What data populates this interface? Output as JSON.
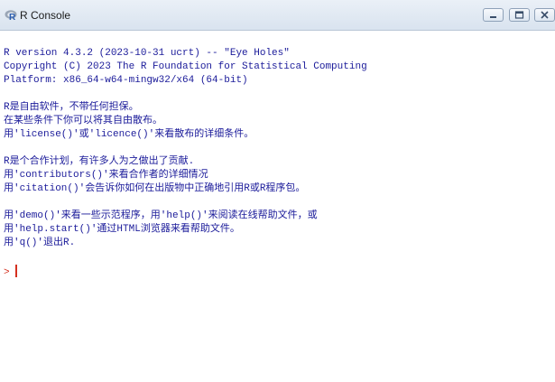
{
  "window": {
    "title": "R Console",
    "accent": "#1b1b9a",
    "prompt_color": "#d4301f"
  },
  "console": {
    "banner": [
      "R version 4.3.2 (2023-10-31 ucrt) -- \"Eye Holes\"",
      "Copyright (C) 2023 The R Foundation for Statistical Computing",
      "Platform: x86_64-w64-mingw32/x64 (64-bit)"
    ],
    "license": [
      "R是自由软件，不带任何担保。",
      "在某些条件下你可以将其自由散布。",
      "用'license()'或'licence()'来看散布的详细条件。"
    ],
    "contrib": [
      "R是个合作计划，有许多人为之做出了贡献.",
      "用'contributors()'来看合作者的详细情况",
      "用'citation()'会告诉你如何在出版物中正确地引用R或R程序包。"
    ],
    "help": [
      "用'demo()'来看一些示范程序，用'help()'来阅读在线帮助文件，或",
      "用'help.start()'通过HTML浏览器来看帮助文件。",
      "用'q()'退出R."
    ],
    "prompt": ">"
  }
}
